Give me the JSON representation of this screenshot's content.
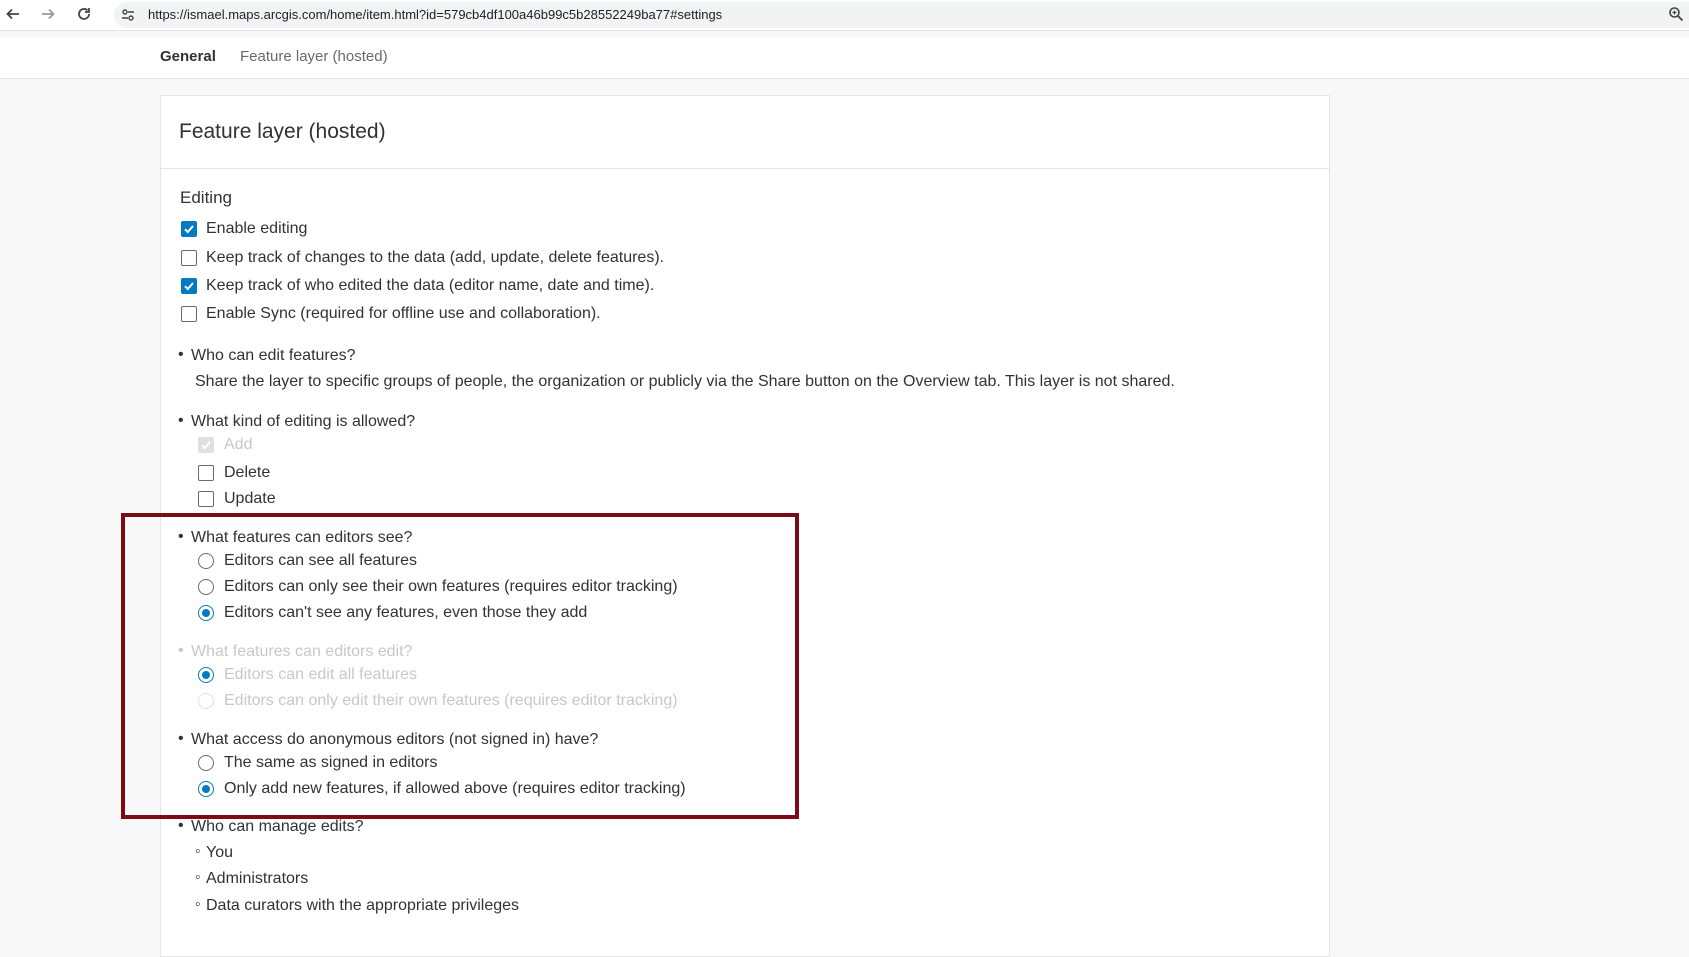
{
  "browser": {
    "url": "https://ismael.maps.arcgis.com/home/item.html?id=579cb4df100a46b99c5b28552249ba77#settings"
  },
  "tabs": [
    {
      "label": "General",
      "active": true
    },
    {
      "label": "Feature layer (hosted)",
      "active": false
    }
  ],
  "card": {
    "title": "Feature layer (hosted)",
    "editing_heading": "Editing",
    "editing_options": [
      {
        "label": "Enable editing",
        "checked": true
      },
      {
        "label": "Keep track of changes to the data (add, update, delete features).",
        "checked": false
      },
      {
        "label": "Keep track of who edited the data (editor name, date and time).",
        "checked": true
      },
      {
        "label": "Enable Sync (required for offline use and collaboration).",
        "checked": false
      }
    ],
    "who_can_edit": {
      "question": "Who can edit features?",
      "description": "Share the layer to specific groups of people, the organization or publicly via the Share button on the Overview tab. This layer is not shared."
    },
    "editing_kind": {
      "question": "What kind of editing is allowed?",
      "options": [
        {
          "label": "Add",
          "checked": true,
          "disabled": true
        },
        {
          "label": "Delete",
          "checked": false,
          "disabled": false
        },
        {
          "label": "Update",
          "checked": false,
          "disabled": false
        }
      ]
    },
    "features_see": {
      "question": "What features can editors see?",
      "options": [
        {
          "label": "Editors can see all features",
          "selected": false
        },
        {
          "label": "Editors can only see their own features (requires editor tracking)",
          "selected": false
        },
        {
          "label": "Editors can't see any features, even those they add",
          "selected": true
        }
      ]
    },
    "features_edit": {
      "question": "What features can editors edit?",
      "disabled": true,
      "options": [
        {
          "label": "Editors can edit all features",
          "selected": true
        },
        {
          "label": "Editors can only edit their own features (requires editor tracking)",
          "selected": false
        }
      ]
    },
    "anonymous_access": {
      "question": "What access do anonymous editors (not signed in) have?",
      "options": [
        {
          "label": "The same as signed in editors",
          "selected": false
        },
        {
          "label": "Only add new features, if allowed above (requires editor tracking)",
          "selected": true
        }
      ]
    },
    "manage_edits": {
      "question": "Who can manage edits?",
      "items": [
        "You",
        "Administrators",
        "Data curators with the appropriate privileges"
      ]
    }
  },
  "colors": {
    "accent": "#007ac2",
    "highlight_border": "#7b0b16"
  },
  "icons": {
    "back": "arrow-left-icon",
    "forward": "arrow-right-icon",
    "reload": "reload-icon",
    "site_info": "site-settings-icon",
    "zoom": "zoom-icon"
  }
}
